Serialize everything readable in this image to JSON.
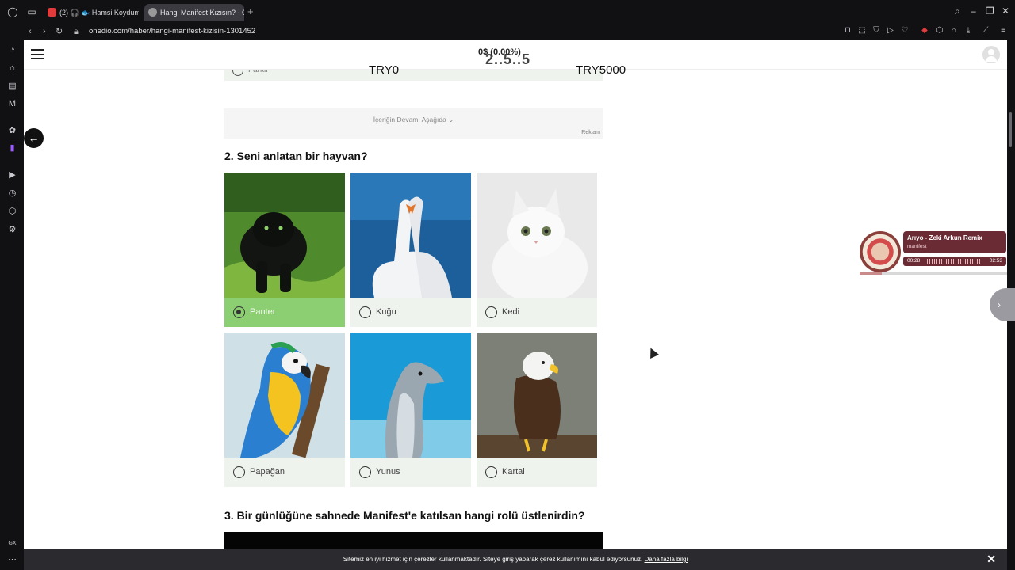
{
  "browser": {
    "tabs": [
      {
        "title": "(2) 🎧 🐟 Hamsi Koydum T",
        "active": false
      },
      {
        "title": "Hangi Manifest Kızısın? - C",
        "active": true
      }
    ],
    "new_tab": "+",
    "url": "onedio.com/haber/hangi-manifest-kizisin-1301452"
  },
  "header": {
    "progress": "0$ (0.00%)",
    "logo_ghost": "2..5..5"
  },
  "slider_overlay": {
    "min_label": "TRY0",
    "max_label": "TRY5000"
  },
  "previous_question": {
    "visible_option": "Farkli"
  },
  "ad": {
    "continue_text": "İçeriğin Devamı Aşağıda ⌄",
    "label": "Reklam"
  },
  "question2": {
    "title": "2. Seni anlatan bir hayvan?",
    "options": [
      {
        "label": "Panter",
        "selected": true,
        "image": "black-panther"
      },
      {
        "label": "Kuğu",
        "selected": false,
        "image": "swans"
      },
      {
        "label": "Kedi",
        "selected": false,
        "image": "white-cat"
      },
      {
        "label": "Papağan",
        "selected": false,
        "image": "parrot"
      },
      {
        "label": "Yunus",
        "selected": false,
        "image": "dolphin"
      },
      {
        "label": "Kartal",
        "selected": false,
        "image": "eagle"
      }
    ]
  },
  "question3": {
    "title": "3. Bir günlüğüne sahnede Manifest'e katılsan hangi rolü üstlenirdin?"
  },
  "cookie_notice": {
    "message": "Sitemiz en iyi hizmet için çerezler kullanmaktadır. Siteye giriş yaparak çerez kullanımını kabul ediyorsunuz.",
    "link": "Daha fazla bilgi",
    "close": "✕"
  },
  "music_player": {
    "title": "Arıyo - Zeki Arkun Remix",
    "artist": "manifest",
    "elapsed": "00:28",
    "duration": "02:53",
    "progress": 0.16
  },
  "colors": {
    "selected_option": "#8ccf72",
    "option_bg": "#eef3ee",
    "cookie_bar": "#2b2b2f"
  }
}
